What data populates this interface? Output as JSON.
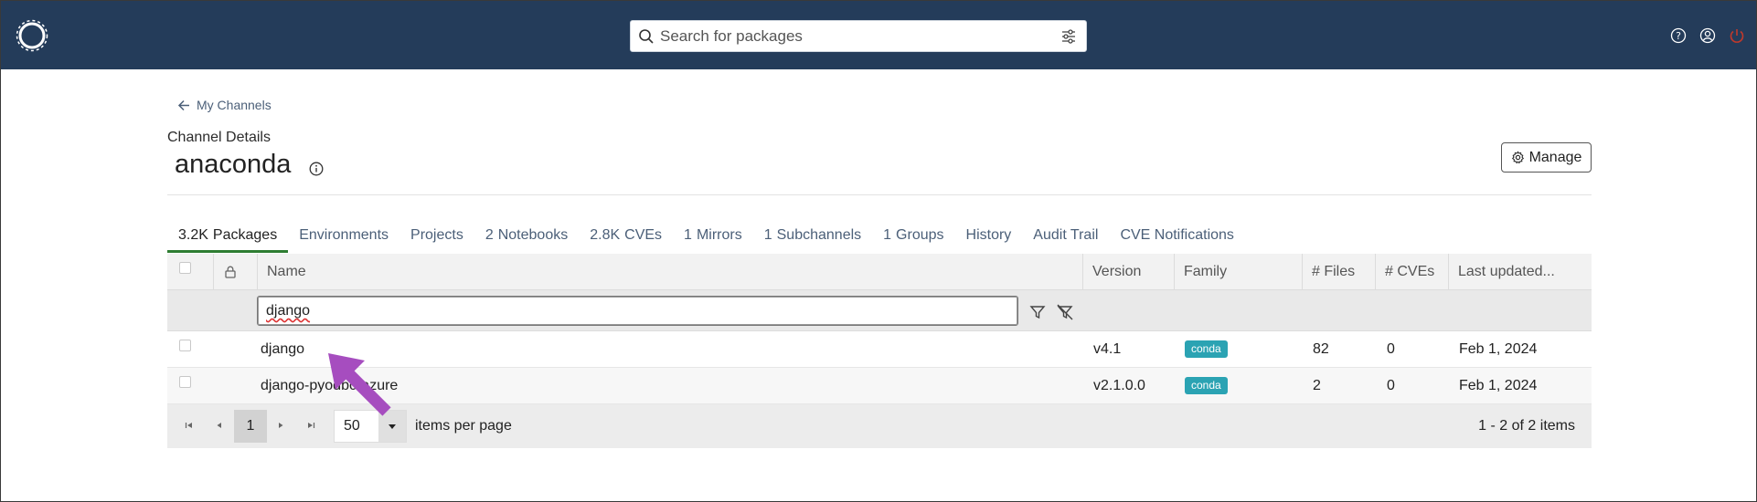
{
  "header": {
    "search_placeholder": "Search for packages"
  },
  "nav": {
    "back_label": "My Channels"
  },
  "channel": {
    "section_title": "Channel Details",
    "name": "anaconda",
    "manage_label": "Manage"
  },
  "tabs": [
    {
      "count": "3.2K",
      "label": "Packages",
      "active": true
    },
    {
      "count": "",
      "label": "Environments"
    },
    {
      "count": "",
      "label": "Projects"
    },
    {
      "count": "2",
      "label": "Notebooks"
    },
    {
      "count": "2.8K",
      "label": "CVEs"
    },
    {
      "count": "1",
      "label": "Mirrors"
    },
    {
      "count": "1",
      "label": "Subchannels"
    },
    {
      "count": "1",
      "label": "Groups"
    },
    {
      "count": "",
      "label": "History"
    },
    {
      "count": "",
      "label": "Audit Trail"
    },
    {
      "count": "",
      "label": "CVE Notifications"
    }
  ],
  "table": {
    "columns": {
      "name": "Name",
      "version": "Version",
      "family": "Family",
      "files": "# Files",
      "cves": "# CVEs",
      "updated": "Last updated..."
    },
    "filter_value": "django",
    "rows": [
      {
        "name": "django",
        "version": "v4.1",
        "family": "conda",
        "files": "82",
        "cves": "0",
        "updated": "Feb 1, 2024"
      },
      {
        "name": "django-pyodbc-azure",
        "version": "v2.1.0.0",
        "family": "conda",
        "files": "2",
        "cves": "0",
        "updated": "Feb 1, 2024"
      }
    ]
  },
  "pager": {
    "current_page": "1",
    "page_size": "50",
    "items_label": "items per page",
    "range_info": "1 - 2 of 2 items"
  },
  "colors": {
    "topbar": "#243c5a",
    "active_tab": "#2e7d32",
    "badge": "#2ba3b3",
    "annotation_arrow": "#a64dbf"
  },
  "icons": [
    "anaconda-logo-icon",
    "search-icon",
    "sliders-icon",
    "help-icon",
    "user-icon",
    "power-icon",
    "arrow-left-icon",
    "info-icon",
    "gear-icon",
    "lock-icon",
    "filter-icon",
    "clear-filter-icon",
    "first-page-icon",
    "prev-page-icon",
    "next-page-icon",
    "last-page-icon",
    "chevron-down-icon"
  ]
}
